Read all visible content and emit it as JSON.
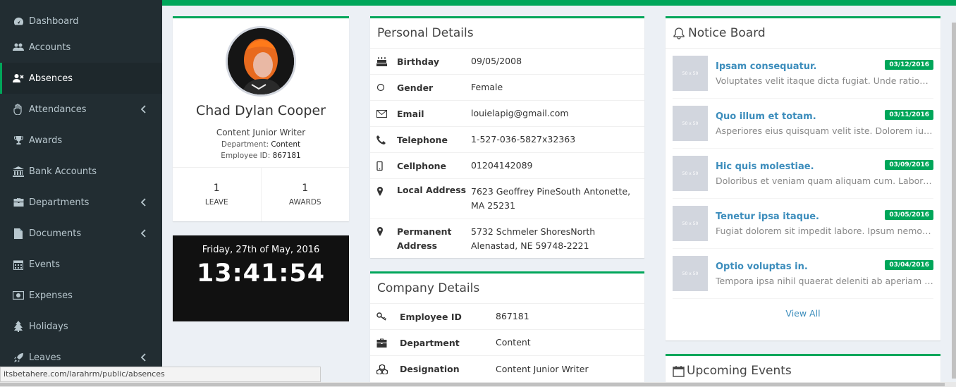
{
  "sidebar": {
    "items": [
      {
        "label": "Dashboard",
        "icon": "dashboard-icon"
      },
      {
        "label": "Accounts",
        "icon": "users-icon"
      },
      {
        "label": "Absences",
        "icon": "user-times-icon"
      },
      {
        "label": "Attendances",
        "icon": "hand-icon"
      },
      {
        "label": "Awards",
        "icon": "trophy-icon"
      },
      {
        "label": "Bank Accounts",
        "icon": "bank-icon"
      },
      {
        "label": "Departments",
        "icon": "briefcase-icon"
      },
      {
        "label": "Documents",
        "icon": "file-icon"
      },
      {
        "label": "Events",
        "icon": "calendar-icon"
      },
      {
        "label": "Expenses",
        "icon": "money-icon"
      },
      {
        "label": "Holidays",
        "icon": "tree-icon"
      },
      {
        "label": "Leaves",
        "icon": "rocket-icon"
      }
    ]
  },
  "profile": {
    "name": "Chad Dylan Cooper",
    "role": "Content Junior Writer",
    "department_label": "Department:",
    "department": "Content",
    "employee_id_label": "Employee ID:",
    "employee_id": "867181",
    "stats": [
      {
        "value": "1",
        "label": "LEAVE"
      },
      {
        "value": "1",
        "label": "AWARDS"
      }
    ]
  },
  "clock": {
    "date": "Friday, 27th of May, 2016",
    "time": "13:41:54"
  },
  "personal": {
    "title": "Personal Details",
    "rows": [
      {
        "label": "Birthday",
        "value": "09/05/2008"
      },
      {
        "label": "Gender",
        "value": "Female"
      },
      {
        "label": "Email",
        "value": "louielapig@gmail.com"
      },
      {
        "label": "Telephone",
        "value": "1-527-036-5827x32363"
      },
      {
        "label": "Cellphone",
        "value": "01204142089"
      },
      {
        "label": "Local Address",
        "value": "7623 Geoffrey PineSouth Antonette, MA 25231"
      },
      {
        "label": "Permanent Address",
        "value": "5732 Schmeler ShoresNorth Alenastad, NE 59748-2221"
      }
    ]
  },
  "company": {
    "title": "Company Details",
    "rows": [
      {
        "label": "Employee ID",
        "value": "867181"
      },
      {
        "label": "Department",
        "value": "Content"
      },
      {
        "label": "Designation",
        "value": "Content Junior Writer"
      }
    ]
  },
  "notice": {
    "title": "Notice Board",
    "thumb_text": "50 x 50",
    "items": [
      {
        "title": "Ipsam consequatur.",
        "desc": "Voluptates velit itaque dicta fugiat. Unde ratione dolor",
        "date": "03/12/2016"
      },
      {
        "title": "Quo illum et totam.",
        "desc": "Asperiores eius quisquam velit iste. Dolorem iure assumenda",
        "date": "03/11/2016"
      },
      {
        "title": "Hic quis molestiae.",
        "desc": "Doloribus et veniam quam aliquam cum. Labore minima",
        "date": "03/09/2016"
      },
      {
        "title": "Tenetur ipsa itaque.",
        "desc": "Fugiat dolorem sit impedit labore. Ipsum nemo ut quia",
        "date": "03/05/2016"
      },
      {
        "title": "Optio voluptas in.",
        "desc": "Tempora ipsa nihil quaerat deleniti ab aperiam consequatur",
        "date": "03/04/2016"
      }
    ],
    "view_all": "View All"
  },
  "events": {
    "title": "Upcoming Events"
  },
  "statusbar": {
    "url": "itsbetahere.com/larahrm/public/absences"
  },
  "colors": {
    "accent": "#00a65a",
    "sidebar_bg": "#222d32",
    "link": "#3c8dbc"
  }
}
